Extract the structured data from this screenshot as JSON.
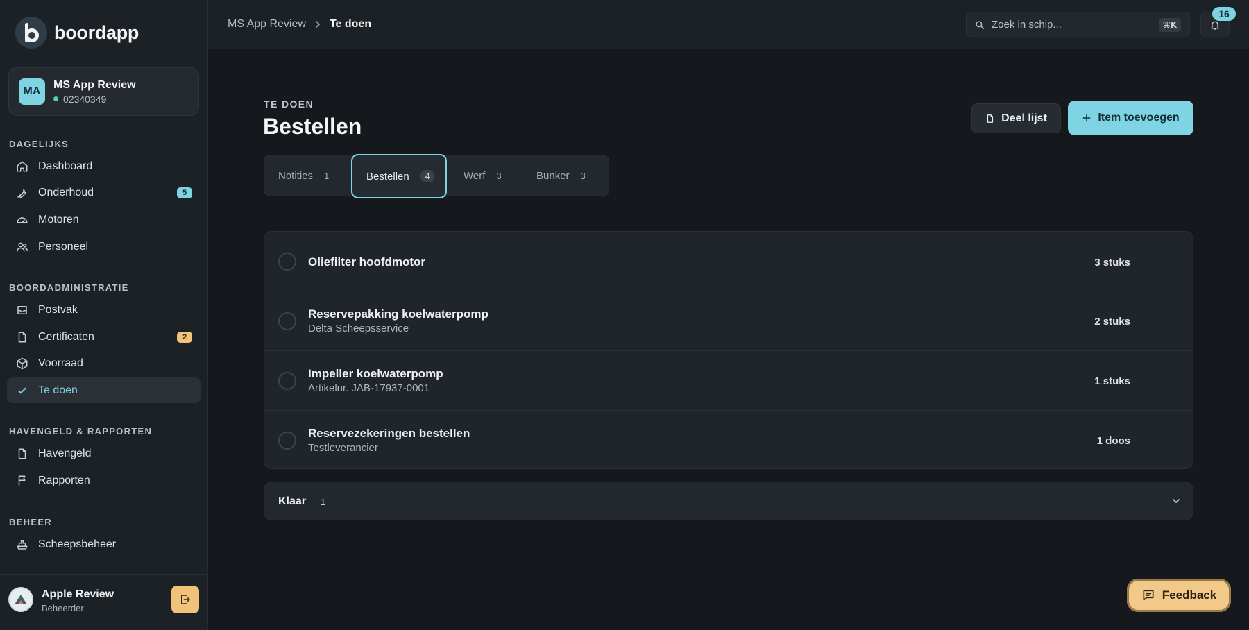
{
  "app": {
    "name": "boordapp"
  },
  "ship": {
    "initials": "MA",
    "name": "MS App Review",
    "number": "02340349"
  },
  "nav": {
    "sections": [
      {
        "heading": "DAGELIJKS",
        "items": [
          {
            "label": "Dashboard",
            "icon": "home-icon"
          },
          {
            "label": "Onderhoud",
            "icon": "wrench-icon",
            "badge": "5"
          },
          {
            "label": "Motoren",
            "icon": "gauge-icon"
          },
          {
            "label": "Personeel",
            "icon": "users-icon"
          }
        ]
      },
      {
        "heading": "BOORDADMINISTRATIE",
        "items": [
          {
            "label": "Postvak",
            "icon": "inbox-icon"
          },
          {
            "label": "Certificaten",
            "icon": "document-icon",
            "badge": "2"
          },
          {
            "label": "Voorraad",
            "icon": "box-icon"
          },
          {
            "label": "Te doen",
            "icon": "check-icon",
            "active": true
          }
        ]
      },
      {
        "heading": "HAVENGELD & RAPPORTEN",
        "items": [
          {
            "label": "Havengeld",
            "icon": "document-icon"
          },
          {
            "label": "Rapporten",
            "icon": "flag-icon"
          }
        ]
      },
      {
        "heading": "BEHEER",
        "items": [
          {
            "label": "Scheepsbeheer",
            "icon": "ship-icon"
          }
        ]
      }
    ]
  },
  "user": {
    "name": "Apple Review",
    "role": "Beheerder"
  },
  "topbar": {
    "breadcrumb": [
      "MS App Review",
      "Te doen"
    ],
    "search_placeholder": "Zoek in schip...",
    "search_shortcut": "⌘K",
    "notifications": "16"
  },
  "page": {
    "eyebrow": "TE DOEN",
    "title": "Bestellen",
    "share_label": "Deel lijst",
    "add_label": "Item toevoegen"
  },
  "tabs": [
    {
      "label": "Notities",
      "count": "1"
    },
    {
      "label": "Bestellen",
      "count": "4",
      "active": true
    },
    {
      "label": "Werf",
      "count": "3"
    },
    {
      "label": "Bunker",
      "count": "3"
    }
  ],
  "items": [
    {
      "title": "Oliefilter hoofdmotor",
      "subtitle": "",
      "quantity": "3 stuks"
    },
    {
      "title": "Reservepakking koelwaterpomp",
      "subtitle": "Delta Scheepsservice",
      "quantity": "2 stuks"
    },
    {
      "title": "Impeller koelwaterpomp",
      "subtitle": "Artikelnr. JAB-17937-0001",
      "quantity": "1 stuks"
    },
    {
      "title": "Reservezekeringen bestellen",
      "subtitle": "Testleverancier",
      "quantity": "1 doos"
    }
  ],
  "done": {
    "label": "Klaar",
    "count": "1"
  },
  "feedback": {
    "label": "Feedback"
  },
  "colors": {
    "accent": "#7fd4e4",
    "warning": "#f0c27a",
    "background": "#15191d",
    "sidebar": "#1c2126"
  }
}
